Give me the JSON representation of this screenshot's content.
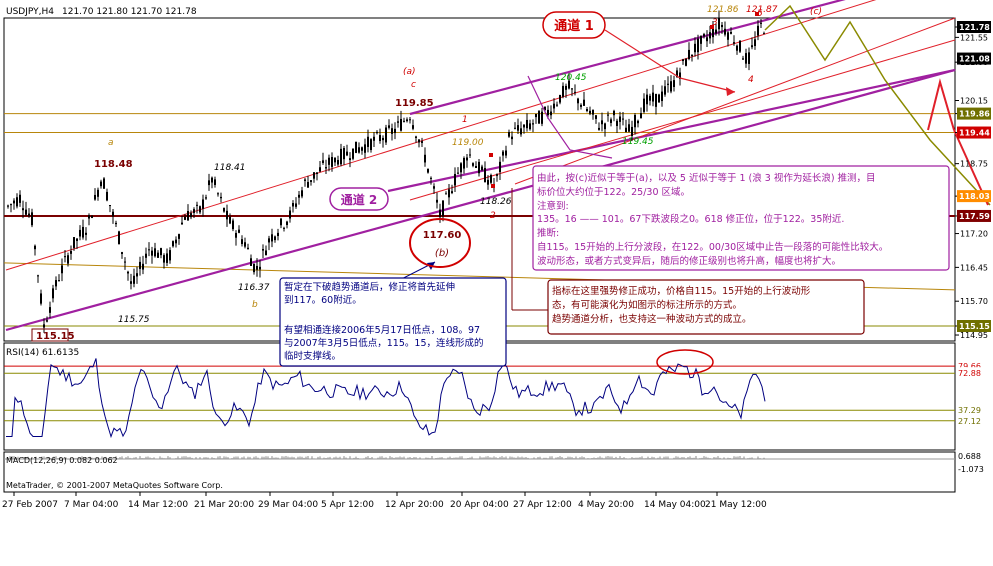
{
  "header": {
    "symbol": "USDJPY,H4",
    "ohlc": "121.70 121.80 121.70 121.78"
  },
  "colors": {
    "bg": "#ffffff",
    "candles": "#000000",
    "channel": "#a020a0",
    "channel_red": "#e0202a",
    "olive": "#8a8a00",
    "label_dark": "#7a0000",
    "orange": "#b8860b",
    "green": "#00a000",
    "tag_red": "#d00000",
    "tag_orange": "#ff8c00",
    "tag_maroon": "#800000",
    "tag_olive": "#707000",
    "rsi_line": "#000080",
    "note_blue": "#000080",
    "note_purple": "#a020a0",
    "note_maroon": "#7a0000"
  },
  "chart_data": {
    "type": "candlestick",
    "title": "USDJPY,H4",
    "ylim": [
      114.6,
      122.4
    ],
    "x_tick_labels": [
      "27 Feb 2007",
      "7 Mar 04:00",
      "14 Mar 12:00",
      "21 Mar 20:00",
      "29 Mar 04:00",
      "5 Apr 12:00",
      "12 Apr 20:00",
      "20 Apr 04:00",
      "27 Apr 12:00",
      "4 May 20:00",
      "14 May 04:00",
      "21 May 12:00"
    ],
    "price_axis_labels": [
      "121.78",
      "121.55",
      "121.00",
      "120.15",
      "119.44",
      "119.86",
      "118.75",
      "117.59",
      "118.03",
      "117.20",
      "116.45",
      "115.70",
      "115.15",
      "114.95"
    ],
    "price_tags": [
      {
        "value": "121.78",
        "color": "#000000"
      },
      {
        "value": "121.08",
        "color": "#000000"
      },
      {
        "value": "119.86",
        "color": "#707000"
      },
      {
        "value": "119.44",
        "color": "#d00000"
      },
      {
        "value": "118.03",
        "color": "#ff8c00"
      },
      {
        "value": "117.59",
        "color": "#800000"
      },
      {
        "value": "115.15",
        "color": "#707000"
      }
    ],
    "swing_points": [
      {
        "label": "115.15",
        "price": 115.15
      },
      {
        "label": "115.75",
        "price": 115.75
      },
      {
        "label": "118.48",
        "price": 118.48
      },
      {
        "label": "116.37",
        "price": 116.37
      },
      {
        "label": "118.41",
        "price": 118.41
      },
      {
        "label": "119.85",
        "price": 119.85
      },
      {
        "label": "117.60",
        "price": 117.6
      },
      {
        "label": "119.00",
        "price": 119.0
      },
      {
        "label": "118.26",
        "price": 118.26
      },
      {
        "label": "120.45",
        "price": 120.45
      },
      {
        "label": "119.45",
        "price": 119.45
      },
      {
        "label": "121.86",
        "price": 121.86
      },
      {
        "label": "121.87",
        "price": 121.87
      }
    ],
    "wave_labels": [
      "a",
      "b",
      "(a)",
      "c",
      "(b)",
      "1",
      "2",
      "3",
      "4",
      "5",
      "(c)"
    ],
    "channel_labels": [
      "通道 1",
      "通道 2"
    ],
    "horizontal_levels": [
      119.86,
      119.44,
      118.03,
      117.59,
      115.15
    ],
    "rsi": {
      "label": "RSI(14) 61.6135",
      "levels": [
        "79.66",
        "72.88",
        "37.29",
        "27.12"
      ]
    },
    "macd": {
      "label": "MACD(12,26,9) 0.082 0.062",
      "levels": [
        "0.688",
        "-1.073"
      ]
    }
  },
  "notes": {
    "n1": {
      "lines": [
        "暂定在下破趋势通道后，修正将首先延伸",
        "到117。60附近。",
        "",
        "有望相通连接2006年5月17日低点，108。97",
        "与2007年3月5日低点，115。15，连线形成的",
        "临时支撑线。"
      ]
    },
    "n2": {
      "lines": [
        "由此，按(c)近似于等于(a)，以及 5 近似于等于 1 (浪 3 视作为延长浪) 推测，目",
        "标价位大约位于122。25/30 区域。",
        "注意到:",
        "135。16 —— 101。67下跌波段之0。618 修正位，位于122。35附近.",
        "推断:",
        "自115。15开始的上行分波段，在122。00/30区域中止告一段落的可能性比较大。",
        "波动形态，或者方式变异后，随后的修正级别也将升高，幅度也将扩大。"
      ]
    },
    "n3": {
      "lines": [
        "指标在这里强势修正成功，价格自115。15开始的上行波动形",
        "态，有可能演化为如图示的标注所示的方式。",
        "趋势通道分析，也支持这一种波动方式的成立。"
      ]
    }
  },
  "footer": {
    "copyright": "MetaTrader, © 2001-2007 MetaQuotes Software Corp."
  }
}
